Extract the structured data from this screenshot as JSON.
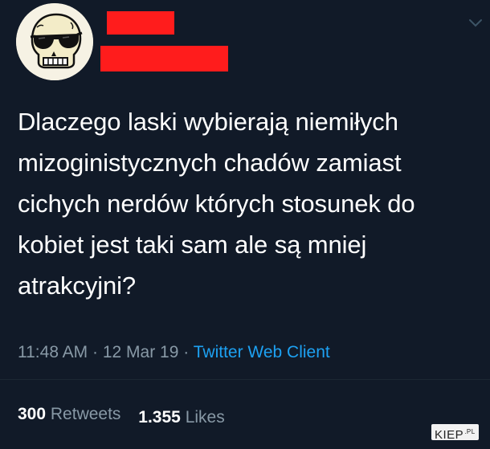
{
  "tweet": {
    "text": "Dlaczego laski wybierają niemiłych mizoginistycznych chadów zamiast cichych nerdów których stosunek do kobiet jest taki sam ale są mniej atrakcyjni?",
    "time": "11:48 AM",
    "separator": "·",
    "date": "12 Mar 19",
    "client": "Twitter Web Client"
  },
  "stats": {
    "retweets_count": "300",
    "retweets_label": "Retweets",
    "likes_count": "1.355",
    "likes_label": "Likes"
  },
  "watermark": {
    "main": "KIEP",
    "suffix": ".PL"
  },
  "colors": {
    "background": "#111a28",
    "text": "#ffffff",
    "muted": "#8899a6",
    "link": "#1da1f2",
    "redaction": "#ff1c1c"
  },
  "icons": {
    "avatar": "skull-sunglasses-avatar",
    "menu": "chevron-down-icon"
  }
}
